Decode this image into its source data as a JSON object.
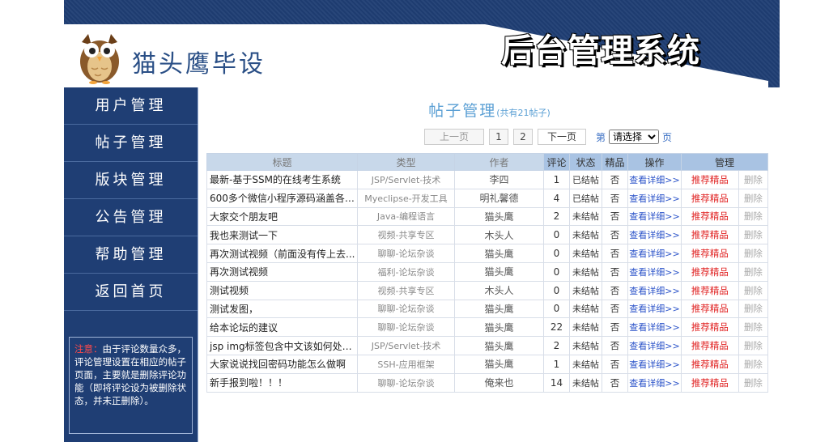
{
  "header": {
    "site_name": "猫头鹰毕设",
    "admin_title": "后台管理系统"
  },
  "sidebar": {
    "items": [
      {
        "label": "用户管理"
      },
      {
        "label": "帖子管理"
      },
      {
        "label": "版块管理"
      },
      {
        "label": "公告管理"
      },
      {
        "label": "帮助管理"
      },
      {
        "label": "返回首页"
      }
    ],
    "notice_label": "注意：",
    "notice_text": "由于评论数量众多，评论管理设置在相应的帖子页面，主要就是删除评论功能（即将评论设为被删除状态，并未正删除）。"
  },
  "main": {
    "title": "帖子管理",
    "count": "(共有21帖子)",
    "pager": {
      "prev": "上一页",
      "page1": "1",
      "page2": "2",
      "next": "下一页",
      "go_prefix": "第",
      "select_value": "请选择",
      "go_suffix": "页"
    },
    "table": {
      "headers": {
        "title": "标题",
        "type": "类型",
        "author": "作者",
        "comments": "评论",
        "state": "状态",
        "fine": "精品",
        "operation": "操作",
        "manage": "管理"
      },
      "rows": [
        {
          "title": "最新-基于SSM的在线考生系统",
          "type": "JSP/Servlet-技术",
          "author": "李四",
          "comments": "1",
          "state": "已结帖",
          "fine": "否",
          "detail": "查看详细>>",
          "rec": "推荐精品",
          "del": "删除"
        },
        {
          "title": "600多个微信小程序源码涵盖各个...",
          "type": "Myeclipse-开发工具",
          "author": "明礼馨德",
          "comments": "4",
          "state": "已结帖",
          "fine": "否",
          "detail": "查看详细>>",
          "rec": "推荐精品",
          "del": "删除"
        },
        {
          "title": "大家交个朋友吧",
          "type": "Java-编程语言",
          "author": "猫头鹰",
          "comments": "2",
          "state": "未结帖",
          "fine": "否",
          "detail": "查看详细>>",
          "rec": "推荐精品",
          "del": "删除"
        },
        {
          "title": "我也来测试一下",
          "type": "视频-共享专区",
          "author": "木头人",
          "comments": "0",
          "state": "未结帖",
          "fine": "否",
          "detail": "查看详细>>",
          "rec": "推荐精品",
          "del": "删除"
        },
        {
          "title": "再次测试视频（前面没有传上去...",
          "type": "聊聊-论坛杂谈",
          "author": "猫头鹰",
          "comments": "0",
          "state": "未结帖",
          "fine": "否",
          "detail": "查看详细>>",
          "rec": "推荐精品",
          "del": "删除"
        },
        {
          "title": "再次测试视频",
          "type": "福利-论坛杂谈",
          "author": "猫头鹰",
          "comments": "0",
          "state": "未结帖",
          "fine": "否",
          "detail": "查看详细>>",
          "rec": "推荐精品",
          "del": "删除"
        },
        {
          "title": "测试视频",
          "type": "视频-共享专区",
          "author": "木头人",
          "comments": "0",
          "state": "未结帖",
          "fine": "否",
          "detail": "查看详细>>",
          "rec": "推荐精品",
          "del": "删除"
        },
        {
          "title": "测试发图，",
          "type": "聊聊-论坛杂谈",
          "author": "猫头鹰",
          "comments": "0",
          "state": "未结帖",
          "fine": "否",
          "detail": "查看详细>>",
          "rec": "推荐精品",
          "del": "删除"
        },
        {
          "title": "给本论坛的建议",
          "type": "聊聊-论坛杂谈",
          "author": "猫头鹰",
          "comments": "22",
          "state": "未结帖",
          "fine": "否",
          "detail": "查看详细>>",
          "rec": "推荐精品",
          "del": "删除"
        },
        {
          "title": "jsp img标签包含中文该如何处理呢",
          "type": "JSP/Servlet-技术",
          "author": "猫头鹰",
          "comments": "2",
          "state": "未结帖",
          "fine": "否",
          "detail": "查看详细>>",
          "rec": "推荐精品",
          "del": "删除"
        },
        {
          "title": "大家说说找回密码功能怎么做啊",
          "type": "SSH-应用框架",
          "author": "猫头鹰",
          "comments": "1",
          "state": "未结帖",
          "fine": "否",
          "detail": "查看详细>>",
          "rec": "推荐精品",
          "del": "删除"
        },
        {
          "title": "新手报到啦！！！",
          "type": "聊聊-论坛杂谈",
          "author": "俺来也",
          "comments": "14",
          "state": "未结帖",
          "fine": "否",
          "detail": "查看详细>>",
          "rec": "推荐精品",
          "del": "删除"
        }
      ]
    }
  },
  "colors": {
    "brand_blue": "#1f3e74",
    "title_blue": "#5a9fd4",
    "table_header": "#a9c3e3",
    "link_blue": "#2b53c9",
    "recommend_red": "#e02020"
  }
}
